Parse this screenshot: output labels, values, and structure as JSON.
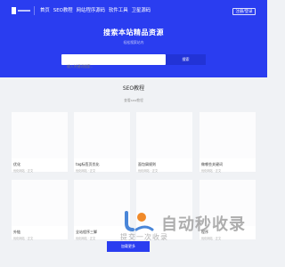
{
  "header": {
    "nav": [
      "首页",
      "SEO教程",
      "网站程序源码",
      "软件工具",
      "卫星源码"
    ],
    "login_label": "注册/登录"
  },
  "hero": {
    "title": "搜索本站精品资源",
    "subtitle": "轻松搜索站内",
    "search_placeholder": "输入关键词搜索..",
    "search_button": "搜索"
  },
  "section": {
    "title": "SEO教程",
    "subtitle": "查看seo教程"
  },
  "cards": [
    {
      "title": "优化",
      "meta": "优化网站 · 正文"
    },
    {
      "title": "tag标签页优化",
      "meta": "优化网站 · 正文"
    },
    {
      "title": "面包屑规则",
      "meta": "优化网站 · 正文"
    },
    {
      "title": "做哪些关键词",
      "meta": "优化网站 · 正文"
    },
    {
      "title": "外链",
      "meta": "优化网站 · 正文"
    },
    {
      "title": "全站程序三脚",
      "meta": "优化网站 · 正文"
    },
    {
      "title": "",
      "meta": ""
    },
    {
      "title": "程序",
      "meta": "优化网站 · 正文"
    }
  ],
  "load_more": "加载更多",
  "watermark": {
    "main": "自动秒收录",
    "sub": "提交一次收录"
  },
  "colors": {
    "brand": "#2a3df0",
    "page_bg": "#f0f2f5"
  }
}
